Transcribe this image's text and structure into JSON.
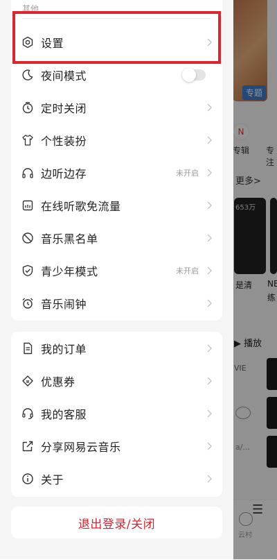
{
  "background": {
    "art_tag": "专题",
    "chip_1": "专辑",
    "chip_2": "专注",
    "chip_icon": "N",
    "more": "更多>",
    "cover_count": "653万",
    "caption_1": "是清",
    "caption_2": "NE",
    "caption_3": "练",
    "play": "▶ 播放",
    "vie": "VIE",
    "slash": "a/...",
    "tab_cloud": "云村"
  },
  "drawer": {
    "section_title": "其他",
    "items": [
      {
        "label": "设置",
        "status": ""
      },
      {
        "label": "夜间模式",
        "status": ""
      },
      {
        "label": "定时关闭",
        "status": ""
      },
      {
        "label": "个性装扮",
        "status": ""
      },
      {
        "label": "边听边存",
        "status": "未开启"
      },
      {
        "label": "在线听歌免流量",
        "status": ""
      },
      {
        "label": "音乐黑名单",
        "status": ""
      },
      {
        "label": "青少年模式",
        "status": "未开启"
      },
      {
        "label": "音乐闹钟",
        "status": ""
      }
    ],
    "items2": [
      {
        "label": "我的订单"
      },
      {
        "label": "优惠券"
      },
      {
        "label": "我的客服"
      },
      {
        "label": "分享网易云音乐"
      },
      {
        "label": "关于"
      }
    ],
    "logout": "退出登录/关闭",
    "night_mode_on": false
  },
  "colors": {
    "accent_red": "#d8232e",
    "highlight_box": "#e0232c"
  }
}
